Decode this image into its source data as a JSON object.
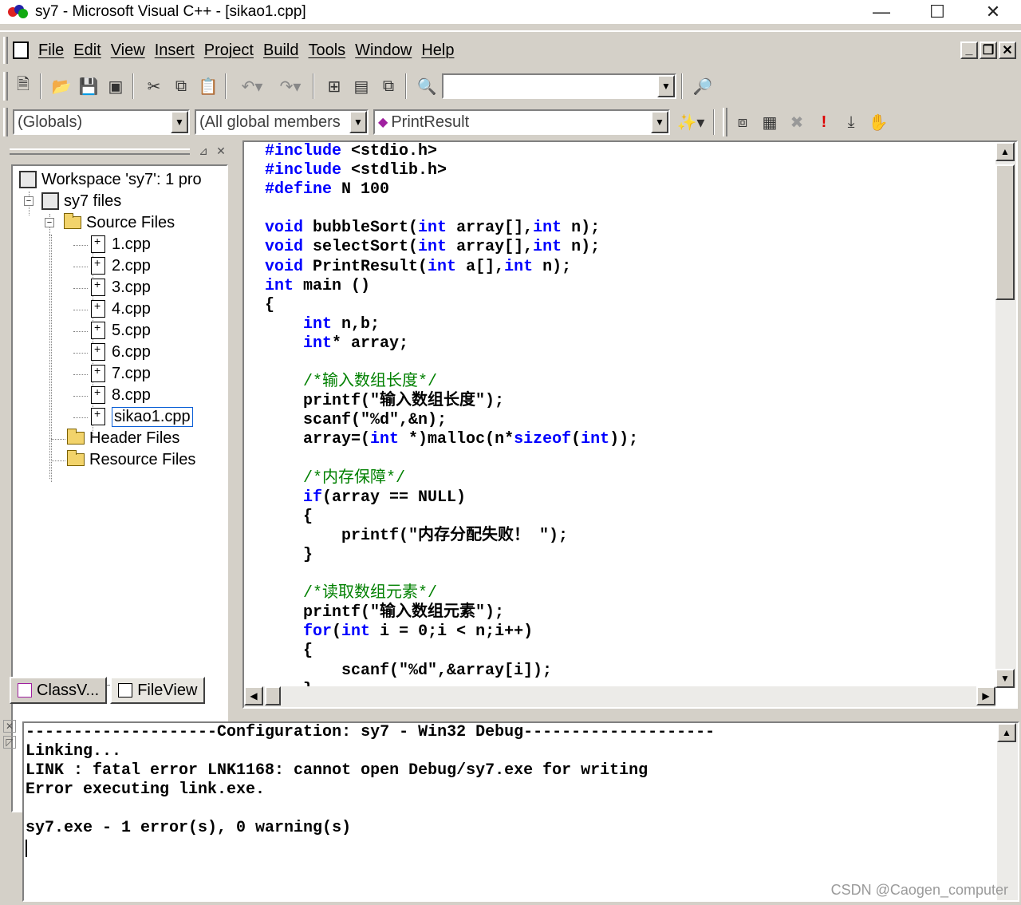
{
  "window": {
    "title": "sy7 - Microsoft Visual C++ - [sikao1.cpp]",
    "minimize": "—",
    "maximize": "☐",
    "close": "✕"
  },
  "menu": [
    "File",
    "Edit",
    "View",
    "Insert",
    "Project",
    "Build",
    "Tools",
    "Window",
    "Help"
  ],
  "mdi_buttons": [
    "_",
    "❐",
    "✕"
  ],
  "toolbar1": {
    "find_combo_value": ""
  },
  "toolbar2": {
    "scope_combo": "(Globals)",
    "members_combo": "(All global members",
    "function_combo": "PrintResult"
  },
  "workspace": {
    "root": "Workspace 'sy7': 1 pro",
    "project": "sy7 files",
    "source_folder": "Source Files",
    "files": [
      "1.cpp",
      "2.cpp",
      "3.cpp",
      "4.cpp",
      "5.cpp",
      "6.cpp",
      "7.cpp",
      "8.cpp",
      "sikao1.cpp"
    ],
    "header_folder": "Header Files",
    "resource_folder": "Resource Files",
    "tabs": [
      "ClassV...",
      "FileView"
    ]
  },
  "code_lines": [
    [
      {
        "t": "#include",
        "c": "kw"
      },
      {
        "t": " <stdio.h>",
        "c": ""
      }
    ],
    [
      {
        "t": "#include",
        "c": "kw"
      },
      {
        "t": " <stdlib.h>",
        "c": ""
      }
    ],
    [
      {
        "t": "#define",
        "c": "kw"
      },
      {
        "t": " N 100",
        "c": ""
      }
    ],
    [],
    [
      {
        "t": "void",
        "c": "kw"
      },
      {
        "t": " bubbleSort(",
        "c": ""
      },
      {
        "t": "int",
        "c": "kw"
      },
      {
        "t": " array[],",
        "c": ""
      },
      {
        "t": "int",
        "c": "kw"
      },
      {
        "t": " n);",
        "c": ""
      }
    ],
    [
      {
        "t": "void",
        "c": "kw"
      },
      {
        "t": " selectSort(",
        "c": ""
      },
      {
        "t": "int",
        "c": "kw"
      },
      {
        "t": " array[],",
        "c": ""
      },
      {
        "t": "int",
        "c": "kw"
      },
      {
        "t": " n);",
        "c": ""
      }
    ],
    [
      {
        "t": "void",
        "c": "kw"
      },
      {
        "t": " PrintResult(",
        "c": ""
      },
      {
        "t": "int",
        "c": "kw"
      },
      {
        "t": " a[],",
        "c": ""
      },
      {
        "t": "int",
        "c": "kw"
      },
      {
        "t": " n);",
        "c": ""
      }
    ],
    [
      {
        "t": "int",
        "c": "kw"
      },
      {
        "t": " main ()",
        "c": ""
      }
    ],
    [
      {
        "t": "{",
        "c": ""
      }
    ],
    [
      {
        "t": "    ",
        "c": ""
      },
      {
        "t": "int",
        "c": "kw"
      },
      {
        "t": " n,b;",
        "c": ""
      }
    ],
    [
      {
        "t": "    ",
        "c": ""
      },
      {
        "t": "int",
        "c": "kw"
      },
      {
        "t": "* array;",
        "c": ""
      }
    ],
    [],
    [
      {
        "t": "    ",
        "c": ""
      },
      {
        "t": "/*输入数组长度*/",
        "c": "cm"
      }
    ],
    [
      {
        "t": "    printf(\"输入数组长度\");",
        "c": ""
      }
    ],
    [
      {
        "t": "    scanf(\"%d\",&n);",
        "c": ""
      }
    ],
    [
      {
        "t": "    array=(",
        "c": ""
      },
      {
        "t": "int",
        "c": "kw"
      },
      {
        "t": " *)malloc(n*",
        "c": ""
      },
      {
        "t": "sizeof",
        "c": "kw"
      },
      {
        "t": "(",
        "c": ""
      },
      {
        "t": "int",
        "c": "kw"
      },
      {
        "t": "));",
        "c": ""
      }
    ],
    [],
    [
      {
        "t": "    ",
        "c": ""
      },
      {
        "t": "/*内存保障*/",
        "c": "cm"
      }
    ],
    [
      {
        "t": "    ",
        "c": ""
      },
      {
        "t": "if",
        "c": "kw"
      },
      {
        "t": "(array == NULL)",
        "c": ""
      }
    ],
    [
      {
        "t": "    {",
        "c": ""
      }
    ],
    [
      {
        "t": "        printf(\"内存分配失败！ \");",
        "c": ""
      }
    ],
    [
      {
        "t": "    }",
        "c": ""
      }
    ],
    [],
    [
      {
        "t": "    ",
        "c": ""
      },
      {
        "t": "/*读取数组元素*/",
        "c": "cm"
      }
    ],
    [
      {
        "t": "    printf(\"输入数组元素\");",
        "c": ""
      }
    ],
    [
      {
        "t": "    ",
        "c": ""
      },
      {
        "t": "for",
        "c": "kw"
      },
      {
        "t": "(",
        "c": ""
      },
      {
        "t": "int",
        "c": "kw"
      },
      {
        "t": " i = 0;i < n;i++)",
        "c": ""
      }
    ],
    [
      {
        "t": "    {",
        "c": ""
      }
    ],
    [
      {
        "t": "        scanf(\"%d\",&array[i]);",
        "c": ""
      }
    ],
    [
      {
        "t": "    }",
        "c": ""
      }
    ]
  ],
  "output": {
    "lines": [
      "--------------------Configuration: sy7 - Win32 Debug--------------------",
      "Linking...",
      "LINK : fatal error LNK1168: cannot open Debug/sy7.exe for writing",
      "Error executing link.exe.",
      "",
      "sy7.exe - 1 error(s), 0 warning(s)"
    ]
  },
  "watermark": "CSDN @Caogen_computer",
  "colors": {
    "keyword": "#0000ff",
    "comment": "#008000",
    "chrome": "#d4d0c8"
  }
}
